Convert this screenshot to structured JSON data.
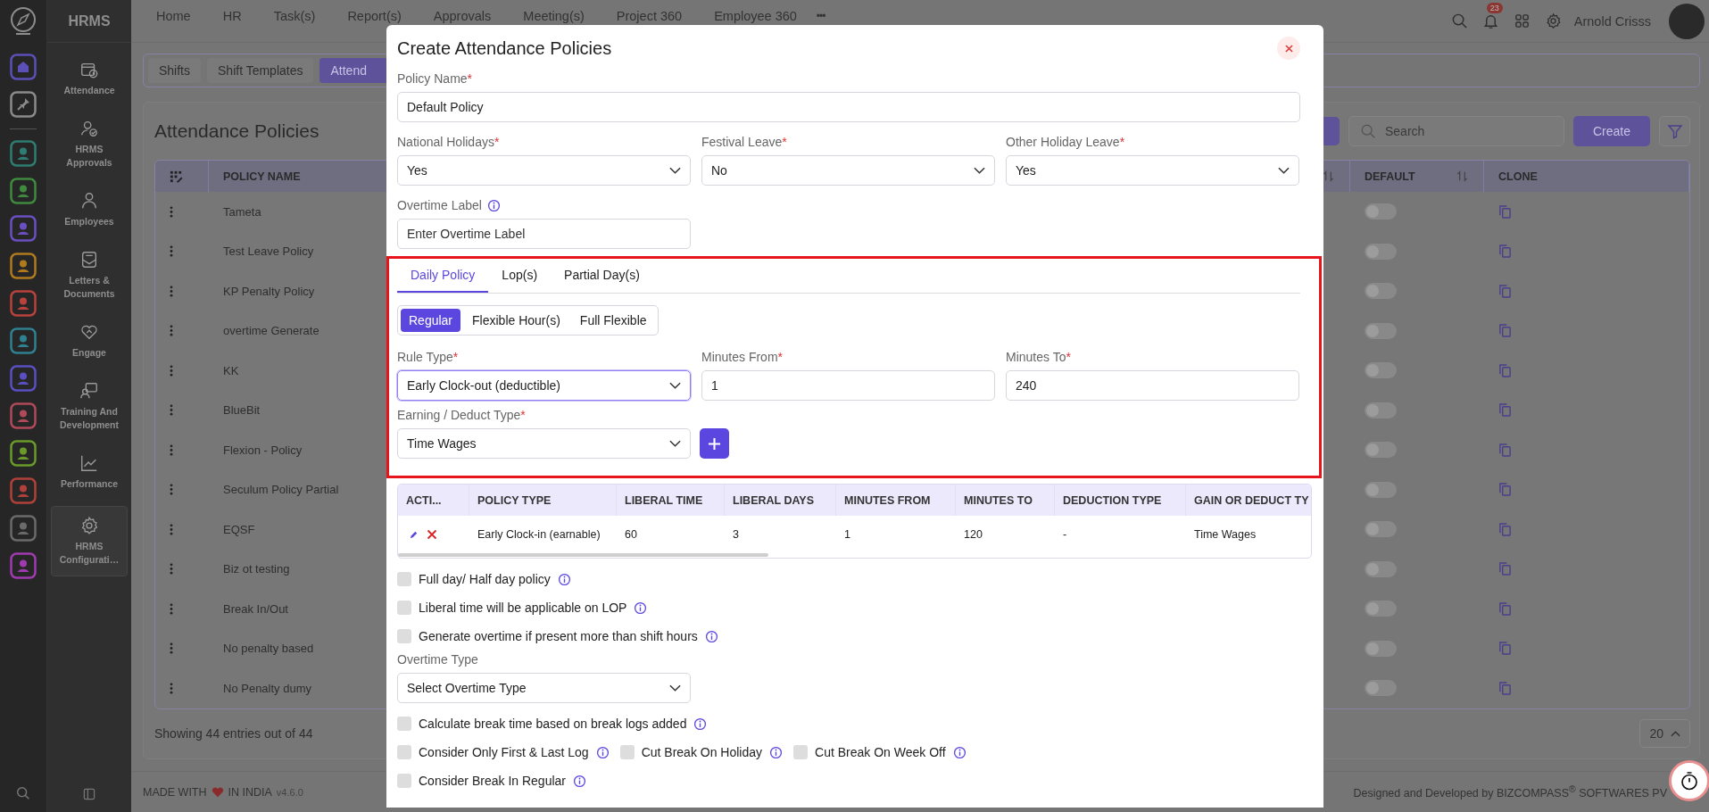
{
  "app": {
    "name": "HRMS"
  },
  "rail": {
    "pinned": [
      {
        "kind": "home",
        "color": "#5b4fb8"
      },
      {
        "kind": "pin",
        "color": "#8a8a8a"
      }
    ],
    "apps": [
      {
        "color": "#2f7d72"
      },
      {
        "color": "#3f8a3f"
      },
      {
        "color": "#6a4fc0"
      },
      {
        "color": "#b07a1e"
      },
      {
        "color": "#b8423e"
      },
      {
        "color": "#2f8090"
      },
      {
        "color": "#5a4fc0"
      },
      {
        "color": "#b04a5a"
      },
      {
        "color": "#6a9a2a"
      },
      {
        "color": "#b0403a"
      },
      {
        "color": "#6a6a6a"
      },
      {
        "color": "#a03ab0"
      }
    ]
  },
  "sidebar": [
    {
      "kind": "calendar",
      "label": "Attendance",
      "selected": false
    },
    {
      "kind": "approval",
      "label": "HRMS Approvals",
      "selected": false
    },
    {
      "kind": "person",
      "label": "Employees",
      "selected": false
    },
    {
      "kind": "letter",
      "label": "Letters & Documents",
      "selected": false
    },
    {
      "kind": "heart",
      "label": "Engage",
      "selected": false
    },
    {
      "kind": "training",
      "label": "Training And Development",
      "selected": false
    },
    {
      "kind": "chart",
      "label": "Performance",
      "selected": false
    },
    {
      "kind": "gear",
      "label": "HRMS Configurati…",
      "selected": true
    }
  ],
  "topnav": {
    "items": [
      "Home",
      "HR",
      "Task(s)",
      "Report(s)",
      "Approvals",
      "Meeting(s)",
      "Project 360",
      "Employee 360"
    ],
    "more": "•••"
  },
  "header": {
    "notifications": "23",
    "user": "Arnold Crisss"
  },
  "page_tabs": [
    {
      "label": "Shifts",
      "selected": false
    },
    {
      "label": "Shift Templates",
      "selected": false
    },
    {
      "label": "Attend",
      "selected": true
    }
  ],
  "page": {
    "title": "Attendance Policies",
    "search": {
      "placeholder": "Search"
    },
    "create": "Create",
    "columns": {
      "name": "POLICY NAME",
      "default": "DEFAULT",
      "clone": "CLONE"
    },
    "rows": [
      {
        "name": "Tameta",
        "default": false
      },
      {
        "name": "Test Leave Policy",
        "default": false
      },
      {
        "name": "KP Penalty Policy",
        "default": false
      },
      {
        "name": "overtime Generate",
        "default": false
      },
      {
        "name": "KK",
        "default": false
      },
      {
        "name": "BlueBit",
        "default": false
      },
      {
        "name": "Flexion - Policy",
        "default": false
      },
      {
        "name": "Seculum Policy Partial",
        "default": false
      },
      {
        "name": "EQSF",
        "default": false
      },
      {
        "name": "Biz ot testing",
        "default": false
      },
      {
        "name": "Break In/Out",
        "default": false
      },
      {
        "name": "No penalty based",
        "default": false
      },
      {
        "name": "No Penalty dumy",
        "default": false
      }
    ],
    "summary": "Showing 44 entries out of 44",
    "page_size": "20"
  },
  "footer": {
    "made_with": "MADE WITH",
    "in_india": "IN INDIA",
    "version": "v4.6.0",
    "credit": "Designed and Developed by BIZCOMPASS$^{®}$ SOFTWARES PV"
  },
  "modal": {
    "title": "Create Attendance Policies",
    "policy_name": {
      "label": "Policy Name",
      "mark": "*",
      "value": "Default Policy"
    },
    "holidays": [
      {
        "label": "National Holidays",
        "mark": "*",
        "value": "Yes"
      },
      {
        "label": "Festival Leave",
        "mark": "*",
        "value": "No"
      },
      {
        "label": "Other Holiday Leave",
        "mark": "*",
        "value": "Yes"
      }
    ],
    "overtime_label": {
      "label": "Overtime Label",
      "info": true,
      "placeholder": "Enter Overtime Label"
    },
    "policy_tabs": [
      {
        "label": "Daily Policy",
        "selected": true
      },
      {
        "label": "Lop(s)",
        "selected": false
      },
      {
        "label": "Partial Day(s)",
        "selected": false
      }
    ],
    "modes": [
      {
        "label": "Regular",
        "selected": true
      },
      {
        "label": "Flexible Hour(s)",
        "selected": false
      },
      {
        "label": "Full Flexible",
        "selected": false
      }
    ],
    "rule_fields": [
      {
        "kind": "select",
        "label": "Rule Type",
        "mark": "*",
        "value": "Early Clock-out (deductible)",
        "focused": true
      },
      {
        "kind": "input",
        "label": "Minutes From",
        "mark": "*",
        "value": "1",
        "focused": false
      },
      {
        "kind": "input",
        "label": "Minutes To",
        "mark": "*",
        "value": "240",
        "focused": false
      }
    ],
    "earning": {
      "label": "Earning / Deduct Type",
      "mark": "*",
      "value": "Time Wages"
    },
    "rules_table": {
      "columns": [
        "ACTI...",
        "POLICY TYPE",
        "LIBERAL TIME",
        "LIBERAL DAYS",
        "MINUTES FROM",
        "MINUTES TO",
        "DEDUCTION TYPE",
        "GAIN OR DEDUCT TY"
      ],
      "rows": [
        {
          "cells": [
            "",
            "Early Clock-in (earnable)",
            "60",
            "3",
            "1",
            "120",
            "-",
            "Time Wages"
          ]
        }
      ]
    },
    "options": [
      {
        "label": "Full day/ Half day policy",
        "checked": false,
        "info": true
      },
      {
        "label": "Liberal time will be applicable on LOP",
        "checked": false,
        "info": true
      },
      {
        "label": "Generate overtime if present more than shift hours",
        "checked": false,
        "info": true
      }
    ],
    "overtime_type": {
      "label": "Overtime Type",
      "placeholder": "Select Overtime Type"
    },
    "break_options": [
      [
        {
          "label": "Calculate break time based on break logs added",
          "checked": false,
          "info": true
        }
      ],
      [
        {
          "label": "Consider Only First & Last Log",
          "checked": false,
          "info": true
        },
        {
          "label": "Cut Break On Holiday",
          "checked": false,
          "info": true
        },
        {
          "label": "Cut Break On Week Off",
          "checked": false,
          "info": true
        }
      ],
      [
        {
          "label": "Consider Break In Regular",
          "checked": false,
          "info": true
        }
      ]
    ]
  }
}
